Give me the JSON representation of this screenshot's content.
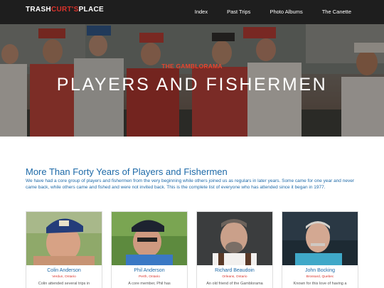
{
  "nav": {
    "logo_part1": "TRASH",
    "logo_part2": "CURT'S",
    "logo_part3": "PLACE",
    "links": [
      "Index",
      "Past Trips",
      "Photo Albums",
      "The Canette"
    ]
  },
  "hero": {
    "kicker": "THE GAMBLORAMA",
    "title": "PLAYERS AND FISHERMEN"
  },
  "main": {
    "heading": "More Than Forty Years of Players and Fishermen",
    "intro": "We have had a core group of players and fishermen from the very beginning while others joined us as regulars in later years. Some came for one year and never came back, while others came and fished and were not invited back. This is the complete list of everyone who has attended since it began in 1977."
  },
  "players": [
    {
      "name": "Colin Anderson",
      "location": "Verdun, Ontario",
      "bio": "Colin attended several trips in"
    },
    {
      "name": "Phil Anderson",
      "location": "Perth, Ontario",
      "bio": "A core member, Phil has"
    },
    {
      "name": "Richard Beaudoin",
      "location": "Orleans, Ontario",
      "bio": "An old friend of the Gamblorama"
    },
    {
      "name": "John Bocking",
      "location": "Brossard, Quebec",
      "bio": "Known for this love of having a"
    }
  ],
  "colors": {
    "accent_red": "#d9322b",
    "accent_blue": "#1e6aa8",
    "nav_bg": "#1e1e1e"
  }
}
